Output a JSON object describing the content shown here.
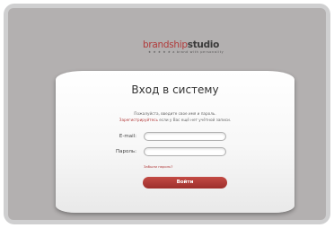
{
  "brand": {
    "name_part1": "brandship",
    "name_part2": "studio",
    "tagline": "★ ★ ★ ★ ★  a brand with personality"
  },
  "login": {
    "title": "Вход в систему",
    "instruction": "Пожалуйста, введите свое имя и пароль.",
    "register_link": "Зарегистрируйтесь",
    "register_suffix": " если у Вас ещё нет учётной записи.",
    "email_label": "E-mail:",
    "email_value": "",
    "password_label": "Пароль:",
    "password_value": "",
    "forgot_link": "Забыли пароль?",
    "submit_label": "Войти"
  },
  "colors": {
    "accent": "#b13b3b",
    "background": "#b3b0b0",
    "frame": "#cfcfd0"
  }
}
